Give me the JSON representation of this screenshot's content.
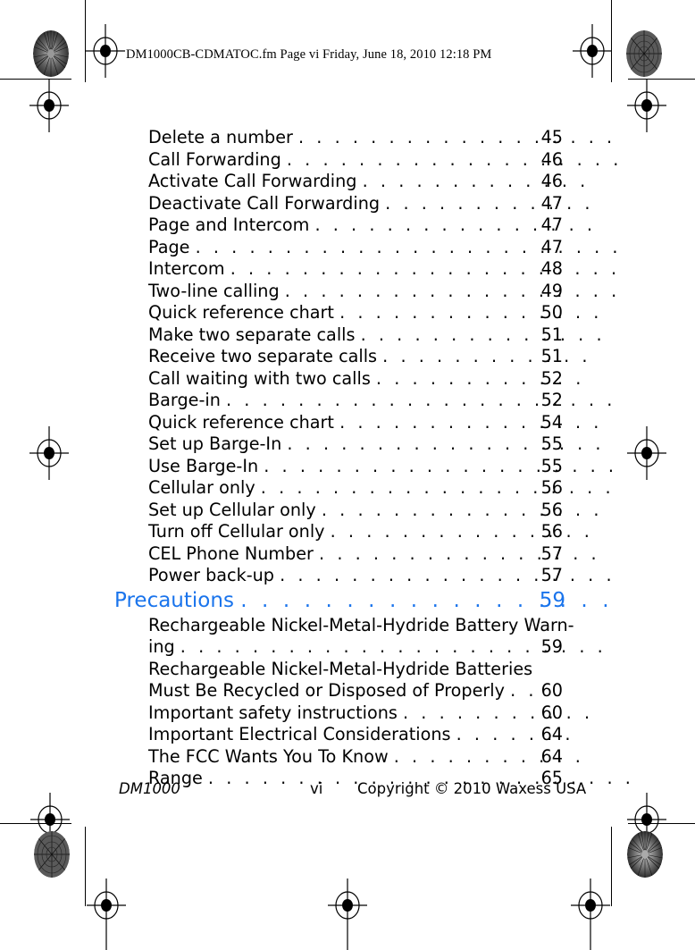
{
  "header": {
    "file_line": "DM1000CB-CDMATOC.fm  Page vi  Friday, June 18, 2010  12:18 PM"
  },
  "toc": {
    "accent_color": "#1a74ec",
    "entries": [
      {
        "label": "Delete a number",
        "leader": ". . . . . . . . . . . . . . . . . .",
        "page": "45",
        "level": "section"
      },
      {
        "label": "Call Forwarding",
        "leader": ". . . . . . . . . . . . . . . . . . .",
        "page": "46",
        "level": "section"
      },
      {
        "label": "Activate Call Forwarding",
        "leader": ". . . . . . . . . . . . .",
        "page": "46",
        "level": "section"
      },
      {
        "label": "Deactivate Call Forwarding",
        "leader": ". . . . . . . . . . . .",
        "page": "47",
        "level": "section"
      },
      {
        "label": "Page and Intercom",
        "leader": ". . . . . . . . . . . . . . . .",
        "page": "47",
        "level": "section"
      },
      {
        "label": "Page",
        "leader": ". . . . . . . . . . . . . . . . . . . . . . . .",
        "page": "47",
        "level": "section"
      },
      {
        "label": "Intercom",
        "leader": ". . . . . . . . . . . . . . . . . . . . . .",
        "page": "48",
        "level": "section"
      },
      {
        "label": "Two-line calling",
        "leader": ". . . . . . . . . . . . . . . . . . .",
        "page": "49",
        "level": "section"
      },
      {
        "label": "Quick reference chart",
        "leader": ". . . . . . . . . . . . . . .",
        "page": "50",
        "level": "section"
      },
      {
        "label": "Make two separate calls",
        "leader": ". . . . . . . . . . . . . .",
        "page": "51",
        "level": "section"
      },
      {
        "label": "Receive two separate calls",
        "leader": ". . . . . . . . . . . .",
        "page": "51",
        "level": "section"
      },
      {
        "label": "Call waiting with two calls",
        "leader": ". . . . . . . . . . . .",
        "page": "52",
        "level": "section"
      },
      {
        "label": "Barge-in",
        "leader": ". . . . . . . . . . . . . . . . . . . . . .",
        "page": "52",
        "level": "section"
      },
      {
        "label": "Quick reference chart",
        "leader": ". . . . . . . . . . . . . . .",
        "page": "54",
        "level": "section"
      },
      {
        "label": "Set up Barge-In",
        "leader": ". . . . . . . . . . . . . . . . . .",
        "page": "55",
        "level": "section"
      },
      {
        "label": "Use Barge-In",
        "leader": ". . . . . . . . . . . . . . . . . . . .",
        "page": "55",
        "level": "section"
      },
      {
        "label": "Cellular only",
        "leader": ". . . . . . . . . . . . . . . . . . . .",
        "page": "56",
        "level": "section"
      },
      {
        "label": "Set up Cellular only",
        "leader": ". . . . . . . . . . . . . . . .",
        "page": "56",
        "level": "section"
      },
      {
        "label": "Turn off Cellular only",
        "leader": ". . . . . . . . . . . . . . .",
        "page": "56",
        "level": "section"
      },
      {
        "label": "CEL Phone Number",
        "leader": ". . . . . . . . . . . . . . . .",
        "page": "57",
        "level": "section"
      },
      {
        "label": "Power back-up",
        "leader": ". . . . . . . . . . . . . . . . . . .",
        "page": "57",
        "level": "section"
      },
      {
        "label": "Precautions",
        "leader": ". . . . . . . . . . . . . . . . . .",
        "page": "59",
        "level": "chapter"
      },
      {
        "label": "Rechargeable Nickel-Metal-Hydride Battery Warn-",
        "leader": "",
        "page": "",
        "level": "section-wrap"
      },
      {
        "label": "ing",
        "leader": "   . . . . . . . . . . . . . . . . . . . . . . . .",
        "page": "59",
        "level": "section"
      },
      {
        "label": "Rechargeable Nickel-Metal-Hydride Batteries",
        "leader": "",
        "page": "",
        "level": "section-wrap"
      },
      {
        "label": "Must Be Recycled or Disposed of Properly",
        "leader": "                                         . .",
        "page": "60",
        "level": "section-short"
      },
      {
        "label": "Important safety instructions",
        "leader": ". . . . . . . . . . .",
        "page": "60",
        "level": "section"
      },
      {
        "label": "Important Electrical Considerations",
        "leader": ". . . . . . .",
        "page": "64",
        "level": "section"
      },
      {
        "label": "The FCC Wants You To Know",
        "leader": ". . . . . . . . . . .",
        "page": "64",
        "level": "section"
      },
      {
        "label": "Range",
        "leader": ". . . . . . . . . . . . . . . . . . . . . . . .",
        "page": "65",
        "level": "section"
      }
    ]
  },
  "footer": {
    "doc_id": "DM1000",
    "page_roman": "vi",
    "copyright": "Copyright © 2010 Waxess USA"
  }
}
